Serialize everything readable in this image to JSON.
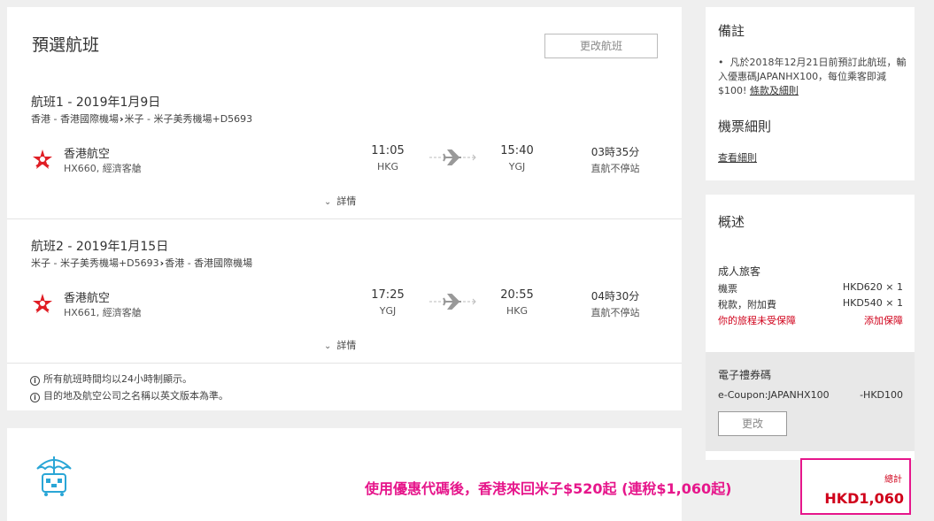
{
  "itinerary": {
    "title": "預選航班",
    "change_flight_label": "更改航班",
    "segments": [
      {
        "heading": "航班1 - 2019年1月9日",
        "route_from": "香港 - 香港國際機場",
        "route_to": "米子 - 米子美秀機場+D5693",
        "airline": "香港航空",
        "flight_info": "HX660, 經濟客艙",
        "depart_time": "11:05",
        "depart_code": "HKG",
        "arrive_time": "15:40",
        "arrive_code": "YGJ",
        "duration": "03時35分",
        "stops": "直航不停站",
        "details_label": "詳情"
      },
      {
        "heading": "航班2 - 2019年1月15日",
        "route_from": "米子 - 米子美秀機場+D5693",
        "route_to": "香港 - 香港國際機場",
        "airline": "香港航空",
        "flight_info": "HX661, 經濟客艙",
        "depart_time": "17:25",
        "depart_code": "YGJ",
        "arrive_time": "20:55",
        "arrive_code": "HKG",
        "duration": "04時30分",
        "stops": "直航不停站",
        "details_label": "詳情"
      }
    ],
    "notes": [
      "所有航班時間均以24小時制顯示。",
      "目的地及航空公司之名稱以英文版本為準。"
    ]
  },
  "remarks": {
    "title": "備註",
    "text": "凡於2018年12月21日前預訂此航班，輸入優惠碼JAPANHX100，每位乘客即減$100!",
    "link": "條款及細則",
    "rules_title": "機票細則",
    "rules_link": "查看細則"
  },
  "summary": {
    "title": "概述",
    "adult_label": "成人旅客",
    "fare_label": "機票",
    "fare_value": "HKD620 × 1",
    "tax_label": "稅款，附加費",
    "tax_value": "HKD540 × 1",
    "insurance_warning": "你的旅程未受保障",
    "add_insurance": "添加保障",
    "coupon_title": "電子禮券碼",
    "coupon_code": "e-Coupon:JAPANHX100",
    "coupon_value": "-HKD100",
    "coupon_change": "更改",
    "total_label": "總計",
    "total_value": "HKD1,060"
  },
  "promo_caption": "使用優惠代碼後，香港來回米子$520起 (連稅$1,060起)",
  "colors": {
    "accent_red": "#d0021b",
    "highlight_pink": "#e6168b",
    "airline_red": "#e01e25",
    "insurance_blue": "#2aa6d6"
  },
  "icons": [
    "hong-kong-airlines-logo-icon",
    "airplane-icon",
    "chevron-down-icon",
    "info-icon",
    "insurance-umbrella-icon"
  ]
}
